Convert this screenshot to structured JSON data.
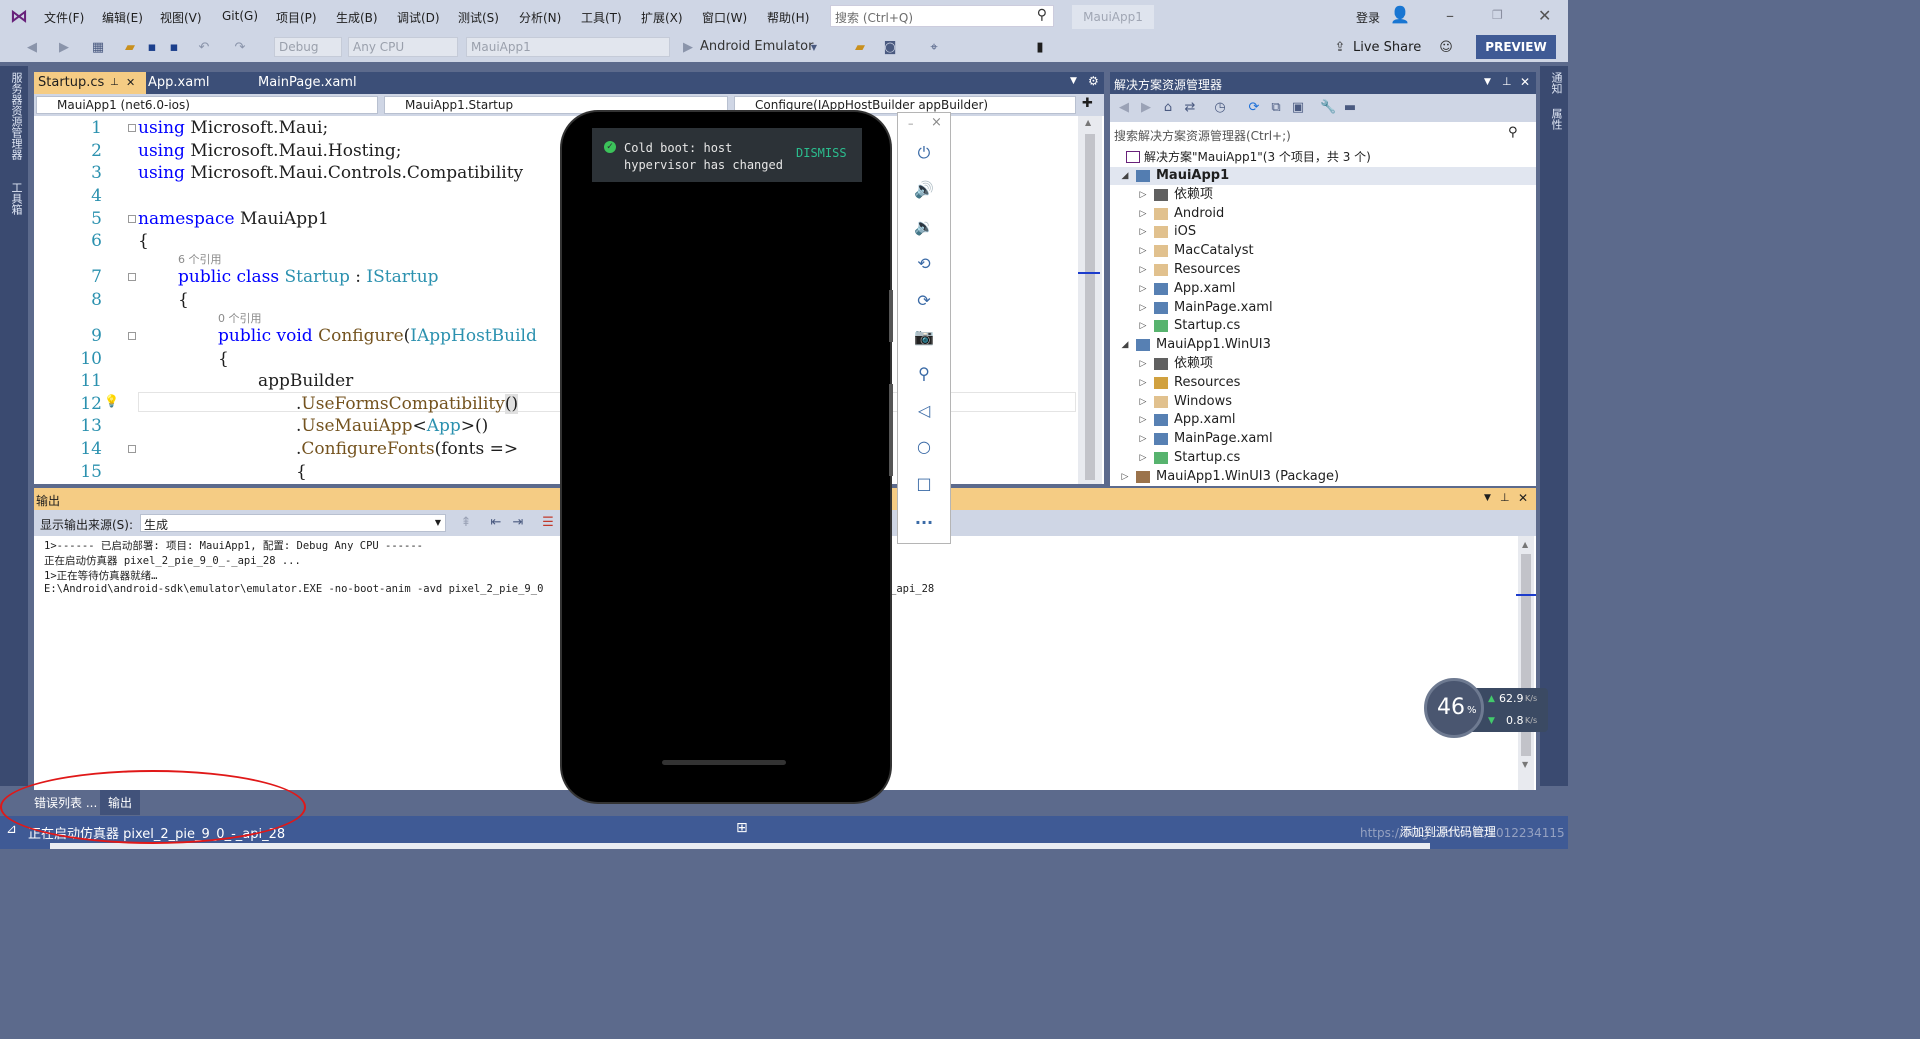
{
  "menu": [
    "文件(F)",
    "编辑(E)",
    "视图(V)",
    "Git(G)",
    "项目(P)",
    "生成(B)",
    "调试(D)",
    "测试(S)",
    "分析(N)",
    "工具(T)",
    "扩展(X)",
    "窗口(W)",
    "帮助(H)"
  ],
  "search": {
    "placeholder": "搜索 (Ctrl+Q)"
  },
  "app_badge": "MauiApp1",
  "account": {
    "login": "登录"
  },
  "toolbar": {
    "config": "Debug",
    "platform": "Any CPU",
    "project": "MauiApp1",
    "run_target": "Android Emulator",
    "live_share": "Live Share",
    "preview": "PREVIEW"
  },
  "left_strip": [
    "服务器资源管理器",
    "工具箱"
  ],
  "right_strip": [
    "通知",
    "属性"
  ],
  "doc_tabs": [
    {
      "label": "Startup.cs",
      "active": true
    },
    {
      "label": "App.xaml",
      "active": false
    },
    {
      "label": "MainPage.xaml",
      "active": false
    }
  ],
  "nav": {
    "project": "MauiApp1 (net6.0-ios)",
    "class": "MauiApp1.Startup",
    "member": "Configure(IAppHostBuilder appBuilder)"
  },
  "code": {
    "line_numbers": [
      "1",
      "2",
      "3",
      "4",
      "5",
      "6",
      "7",
      "8",
      "9",
      "10",
      "11",
      "12",
      "13",
      "14",
      "15"
    ],
    "l1_kw": "using",
    "l1_rest": " Microsoft.Maui;",
    "l2_kw": "using",
    "l2_rest": " Microsoft.Maui.Hosting;",
    "l3_kw": "using",
    "l3_rest": " Microsoft.Maui.Controls.Compatibility",
    "l5_kw": "namespace",
    "l5_rest": " MauiApp1",
    "l6": "{",
    "ref1": "6 个引用",
    "l7_kw": "public class",
    "l7_type": "Startup",
    "l7_sep": " : ",
    "l7_iface": "IStartup",
    "l8": "{",
    "ref2": "0 个引用",
    "l9_kw": "public void",
    "l9_fn": "Configure",
    "l9_paren": "(",
    "l9_type": "IAppHostBuild",
    "l10": "{",
    "l11": "appBuilder",
    "l12_dot": ".",
    "l12_fn": "UseFormsCompatibility",
    "l12_tail": "()",
    "l13_dot": ".",
    "l13_fn": "UseMauiApp",
    "l13_lt": "<",
    "l13_type": "App",
    "l13_tail": ">()",
    "l14_dot": ".",
    "l14_fn": "ConfigureFonts",
    "l14_tail": "(fonts =>",
    "l15": "{"
  },
  "output": {
    "title": "输出",
    "source_label": "显示输出来源(S):",
    "source_value": "生成",
    "lines": [
      "1>------ 已启动部署: 项目: MauiApp1, 配置: Debug Any CPU ------",
      "正在启动仿真器 pixel_2_pie_9_0_-_api_28 ...",
      "1>正在等待仿真器就绪…",
      "E:\\Android\\android-sdk\\emulator\\emulator.EXE -no-boot-anim -avd pixel_2_pie_9_0"
    ],
    "line4_tail": "_api_28"
  },
  "bottom_tabs": [
    "错误列表 ...",
    "输出"
  ],
  "status": {
    "text": "正在启动仿真器 pixel_2_pie_9_0_-_api_28",
    "source_control": "添加到源代码管理",
    "watermark": "https://blog.csdn.net/u012234115"
  },
  "solution": {
    "title": "解决方案资源管理器",
    "search_placeholder": "搜索解决方案资源管理器(Ctrl+;)",
    "root": "解决方案\"MauiApp1\"(3 个项目，共 3 个)",
    "items": [
      {
        "label": "MauiApp1",
        "level": 1,
        "arrow": "◢",
        "icon": "csharp-project-icon",
        "bold": true
      },
      {
        "label": "依赖项",
        "level": 2,
        "arrow": "▷",
        "icon": "dependencies-icon"
      },
      {
        "label": "Android",
        "level": 2,
        "arrow": "▷",
        "icon": "folder-icon"
      },
      {
        "label": "iOS",
        "level": 2,
        "arrow": "▷",
        "icon": "folder-icon"
      },
      {
        "label": "MacCatalyst",
        "level": 2,
        "arrow": "▷",
        "icon": "folder-icon"
      },
      {
        "label": "Resources",
        "level": 2,
        "arrow": "▷",
        "icon": "folder-icon"
      },
      {
        "label": "App.xaml",
        "level": 2,
        "arrow": "▷",
        "icon": "xaml-file-icon"
      },
      {
        "label": "MainPage.xaml",
        "level": 2,
        "arrow": "▷",
        "icon": "xaml-file-icon"
      },
      {
        "label": "Startup.cs",
        "level": 2,
        "arrow": "▷",
        "icon": "csharp-file-icon"
      },
      {
        "label": "MauiApp1.WinUI3",
        "level": 1,
        "arrow": "◢",
        "icon": "csharp-project-icon"
      },
      {
        "label": "依赖项",
        "level": 2,
        "arrow": "▷",
        "icon": "dependencies-icon"
      },
      {
        "label": "Resources",
        "level": 2,
        "arrow": "▷",
        "icon": "resources-icon"
      },
      {
        "label": "Windows",
        "level": 2,
        "arrow": "▷",
        "icon": "folder-icon"
      },
      {
        "label": "App.xaml",
        "level": 2,
        "arrow": "▷",
        "icon": "xaml-file-icon"
      },
      {
        "label": "MainPage.xaml",
        "level": 2,
        "arrow": "▷",
        "icon": "xaml-file-icon"
      },
      {
        "label": "Startup.cs",
        "level": 2,
        "arrow": "▷",
        "icon": "csharp-file-icon"
      },
      {
        "label": "MauiApp1.WinUI3 (Package)",
        "level": 1,
        "arrow": "▷",
        "icon": "package-icon"
      }
    ]
  },
  "emulator": {
    "toast_line1": "Cold boot: host",
    "toast_line2": "hypervisor has changed",
    "dismiss": "DISMISS",
    "panel_min": "–",
    "panel_close": "×",
    "more": "..."
  },
  "network": {
    "cpu": "46",
    "cpu_unit": "%",
    "up": "62.9",
    "down": "0.8",
    "unit": "K/s"
  },
  "colors": {
    "accent": "#3f5a95",
    "output_header": "#f5cc84",
    "keyword": "#0000ff",
    "type": "#2b91af"
  }
}
